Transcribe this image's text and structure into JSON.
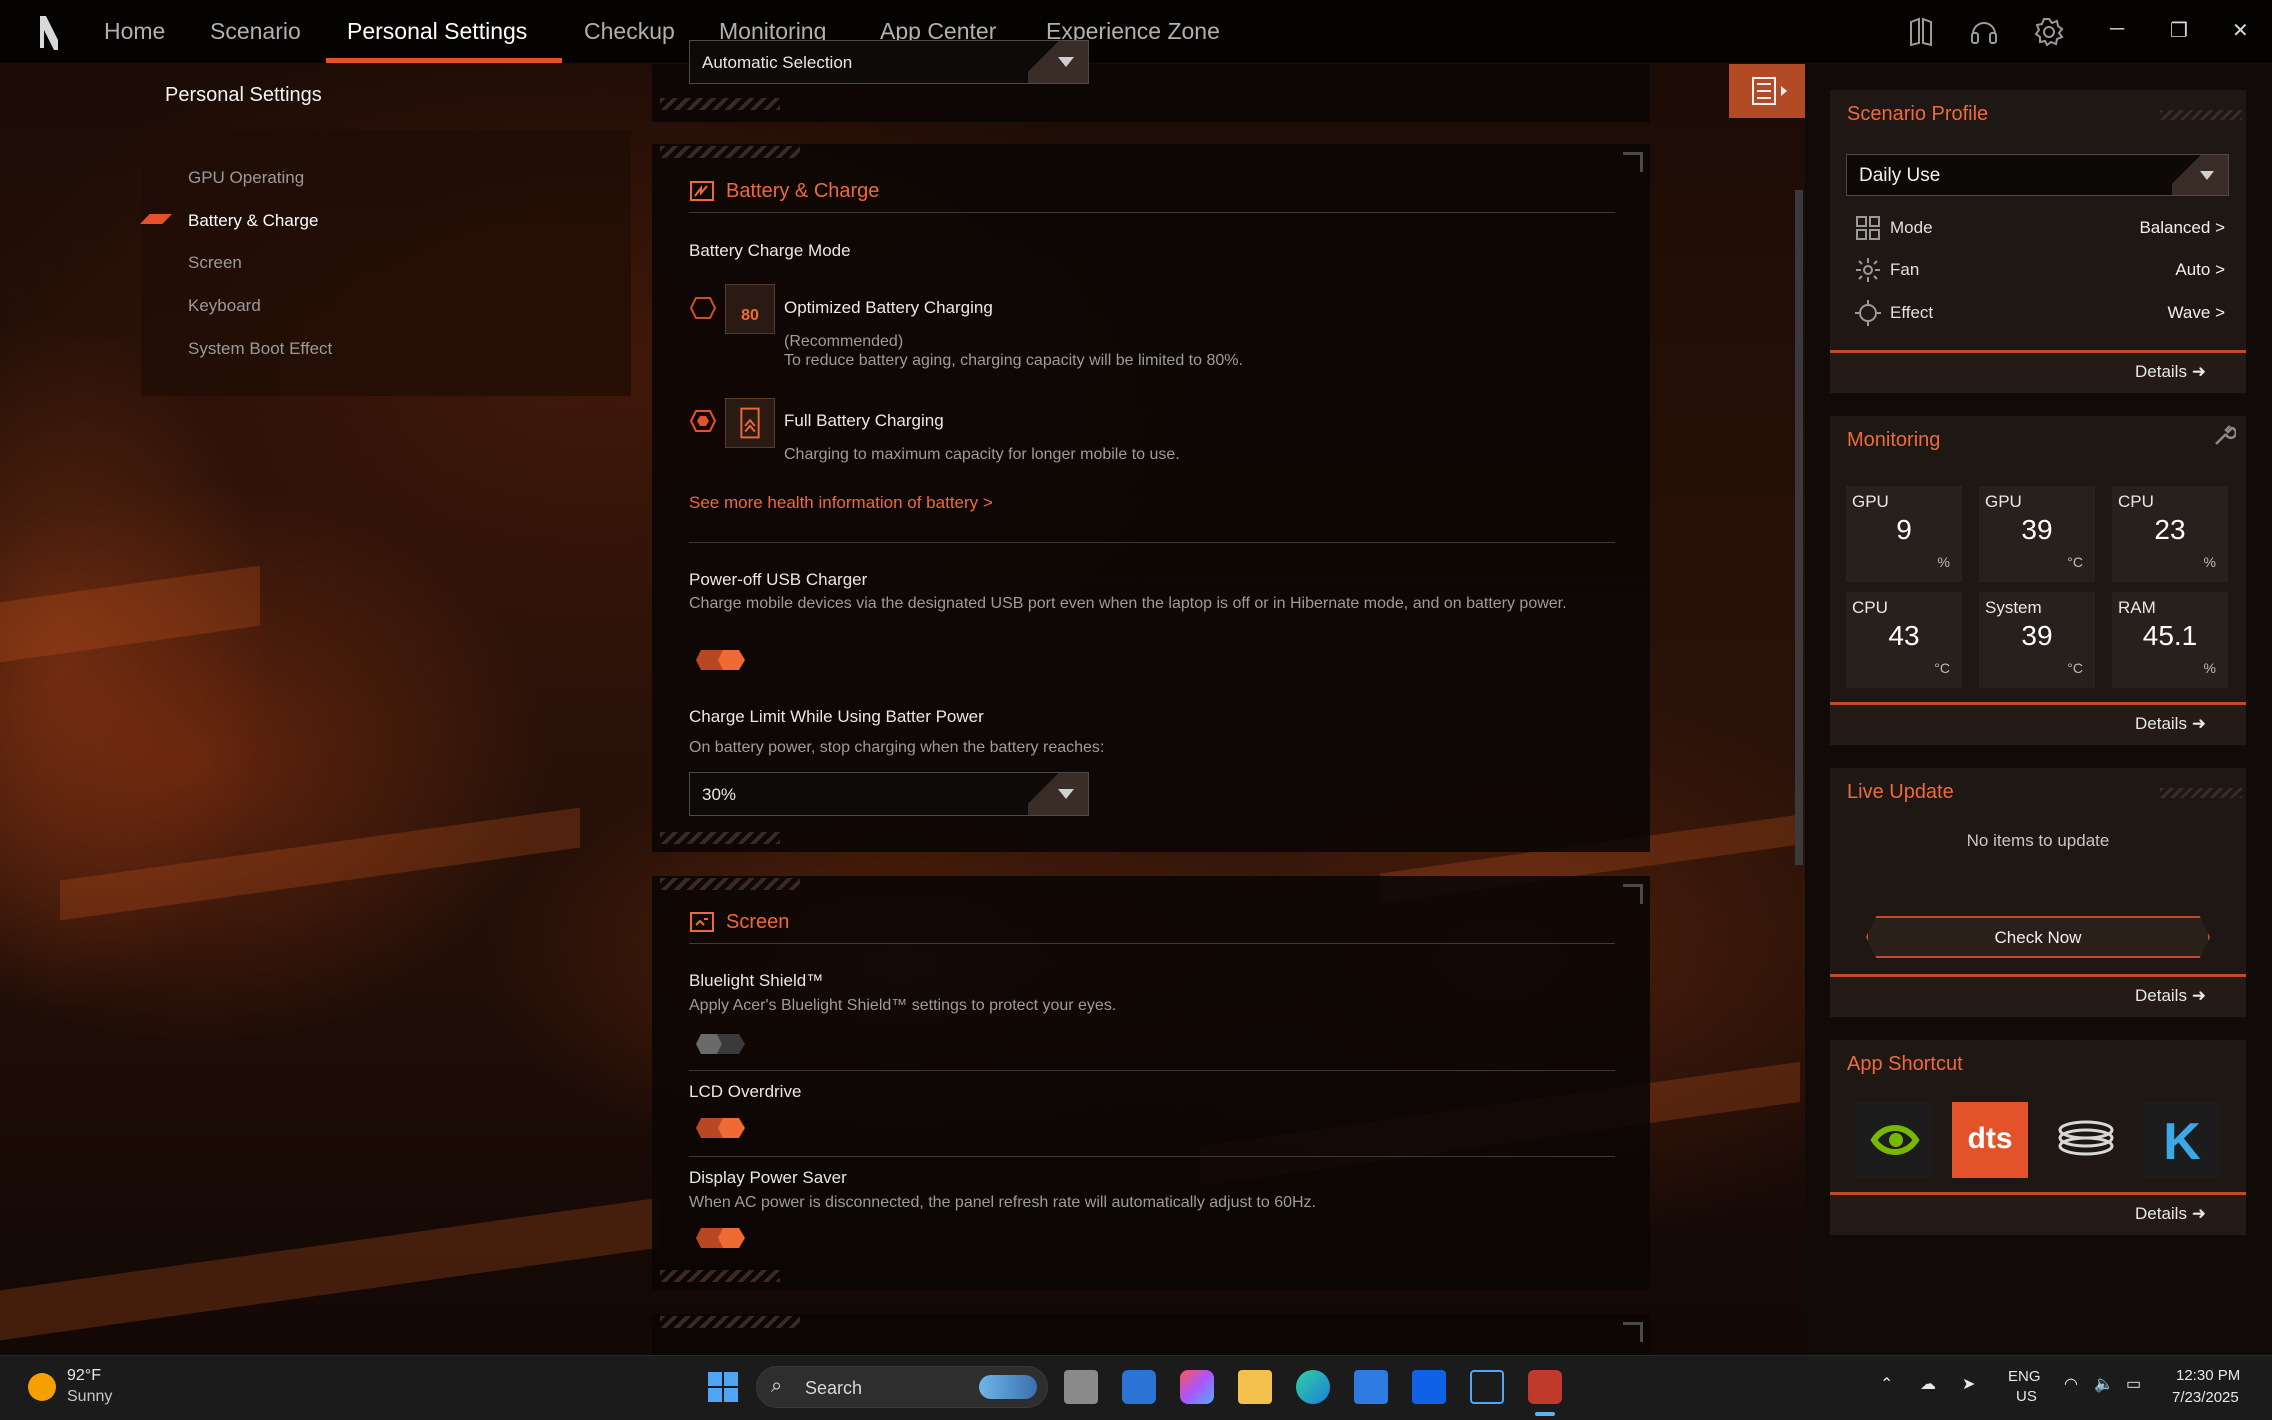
{
  "nav": {
    "tabs": [
      "Home",
      "Scenario",
      "Personal Settings",
      "Checkup",
      "Monitoring",
      "App Center",
      "Experience Zone"
    ],
    "active_tab": "Personal Settings"
  },
  "sidebar": {
    "title": "Personal Settings",
    "items": [
      "GPU Operating",
      "Battery & Charge",
      "Screen",
      "Keyboard",
      "System Boot Effect"
    ],
    "active": "Battery & Charge"
  },
  "top_dropdown": {
    "value": "Automatic Selection"
  },
  "battery": {
    "title": "Battery & Charge",
    "mode_label": "Battery Charge Mode",
    "optimized": {
      "title": "Optimized Battery Charging",
      "badge": "80",
      "line1": "(Recommended)",
      "line2": "To reduce battery aging, charging capacity will be limited to 80%.",
      "selected": false
    },
    "full": {
      "title": "Full Battery Charging",
      "desc": "Charging to maximum capacity for longer mobile to use.",
      "selected": true
    },
    "health_link": "See more health information of battery",
    "usb": {
      "label": "Power-off USB Charger",
      "desc": "Charge mobile devices via the designated USB port even when the laptop is off or in Hibernate mode, and on battery power.",
      "on": true
    },
    "charge_limit": {
      "label": "Charge Limit While Using Batter Power",
      "desc": "On battery power, stop charging when the battery reaches:",
      "value": "30%"
    }
  },
  "screen": {
    "title": "Screen",
    "bluelight": {
      "label": "Bluelight Shield™",
      "desc": "Apply Acer's Bluelight Shield™ settings to protect your eyes.",
      "on": false
    },
    "overdrive": {
      "label": "LCD Overdrive",
      "on": true
    },
    "saver": {
      "label": "Display Power Saver",
      "desc": "When AC power is disconnected, the panel refresh rate will automatically adjust to 60Hz.",
      "on": true
    }
  },
  "profile": {
    "title": "Scenario Profile",
    "selected": "Daily Use",
    "rows": [
      {
        "label": "Mode",
        "value": "Balanced",
        "icon": "grid-icon"
      },
      {
        "label": "Fan",
        "value": "Auto",
        "icon": "fan-icon"
      },
      {
        "label": "Effect",
        "value": "Wave",
        "icon": "effect-icon"
      }
    ],
    "details": "Details"
  },
  "monitoring": {
    "title": "Monitoring",
    "tiles": [
      {
        "name": "GPU",
        "value": "9",
        "unit": "%"
      },
      {
        "name": "GPU",
        "value": "39",
        "unit": "°C"
      },
      {
        "name": "CPU",
        "value": "23",
        "unit": "%"
      },
      {
        "name": "CPU",
        "value": "43",
        "unit": "°C"
      },
      {
        "name": "System",
        "value": "39",
        "unit": "°C"
      },
      {
        "name": "RAM",
        "value": "45.1",
        "unit": "%"
      }
    ],
    "details": "Details"
  },
  "live_update": {
    "title": "Live Update",
    "empty": "No items to update",
    "button": "Check Now",
    "details": "Details"
  },
  "app_shortcut": {
    "title": "App Shortcut",
    "apps": [
      "nvidia-icon",
      "dts-icon",
      "coil-icon",
      "k-icon"
    ],
    "dts_label": "dts",
    "k_label": "K",
    "details": "Details"
  },
  "taskbar": {
    "temp": "92°F",
    "weather": "Sunny",
    "search_placeholder": "Search",
    "lang1": "ENG",
    "lang2": "US",
    "time": "12:30 PM",
    "date": "7/23/2025"
  },
  "colors": {
    "accent": "#e4522a",
    "title": "#ef6a3a"
  }
}
